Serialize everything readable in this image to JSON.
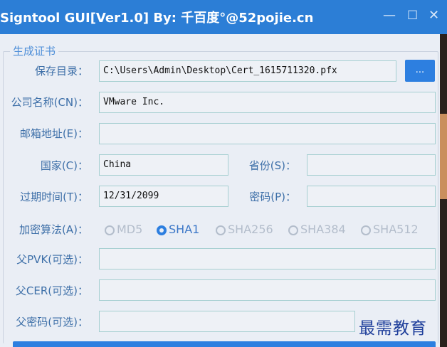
{
  "window": {
    "title": "Signtool GUI[Ver1.0]   By: 千百度°@52pojie.cn",
    "minimize": "—",
    "maximize": "☐",
    "close": "✕"
  },
  "group": {
    "legend": "生成证书"
  },
  "form": {
    "save_dir_label": "保存目录：",
    "save_dir_value": "C:\\Users\\Admin\\Desktop\\Cert_1615711320.pfx",
    "browse_label": "...",
    "company_label": "公司名称(CN)：",
    "company_value": "VMware Inc.",
    "email_label": "邮箱地址(E)：",
    "email_value": "",
    "country_label": "国家(C)：",
    "country_value": "China",
    "province_label": "省份(S)：",
    "province_value": "",
    "expiry_label": "过期时间(T)：",
    "expiry_value": "12/31/2099",
    "password_label": "密码(P)：",
    "password_value": "",
    "algo_label": "加密算法(A)：",
    "algorithms": [
      {
        "label": "MD5",
        "checked": false
      },
      {
        "label": "SHA1",
        "checked": true
      },
      {
        "label": "SHA256",
        "checked": false
      },
      {
        "label": "SHA384",
        "checked": false
      },
      {
        "label": "SHA512",
        "checked": false
      }
    ],
    "parent_pvk_label": "父PVK(可选)：",
    "parent_pvk_value": "",
    "parent_cer_label": "父CER(可选)：",
    "parent_cer_value": "",
    "parent_pwd_label": "父密码(可选)：",
    "parent_pwd_value": ""
  },
  "watermark": "最需教育",
  "colors": {
    "accent": "#2d7fe0",
    "label": "#3d6fa8",
    "titlebar": "#2c7ed6"
  }
}
